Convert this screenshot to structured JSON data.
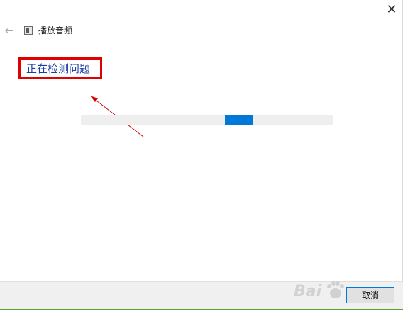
{
  "window": {
    "title": "播放音频",
    "close_glyph": "✕",
    "back_glyph": "←"
  },
  "main": {
    "heading": "正在检测问题",
    "progress": {
      "state": "indeterminate",
      "fill_color": "#0078d7",
      "track_color": "#eeeeee"
    }
  },
  "annotation": {
    "highlight_color": "#e00000"
  },
  "footer": {
    "cancel_label": "取消"
  },
  "watermark": {
    "brand": "Baidu"
  },
  "colors": {
    "heading": "#1c3fa5",
    "footer_bg": "#f0f0f0",
    "accent": "#0078d7"
  }
}
